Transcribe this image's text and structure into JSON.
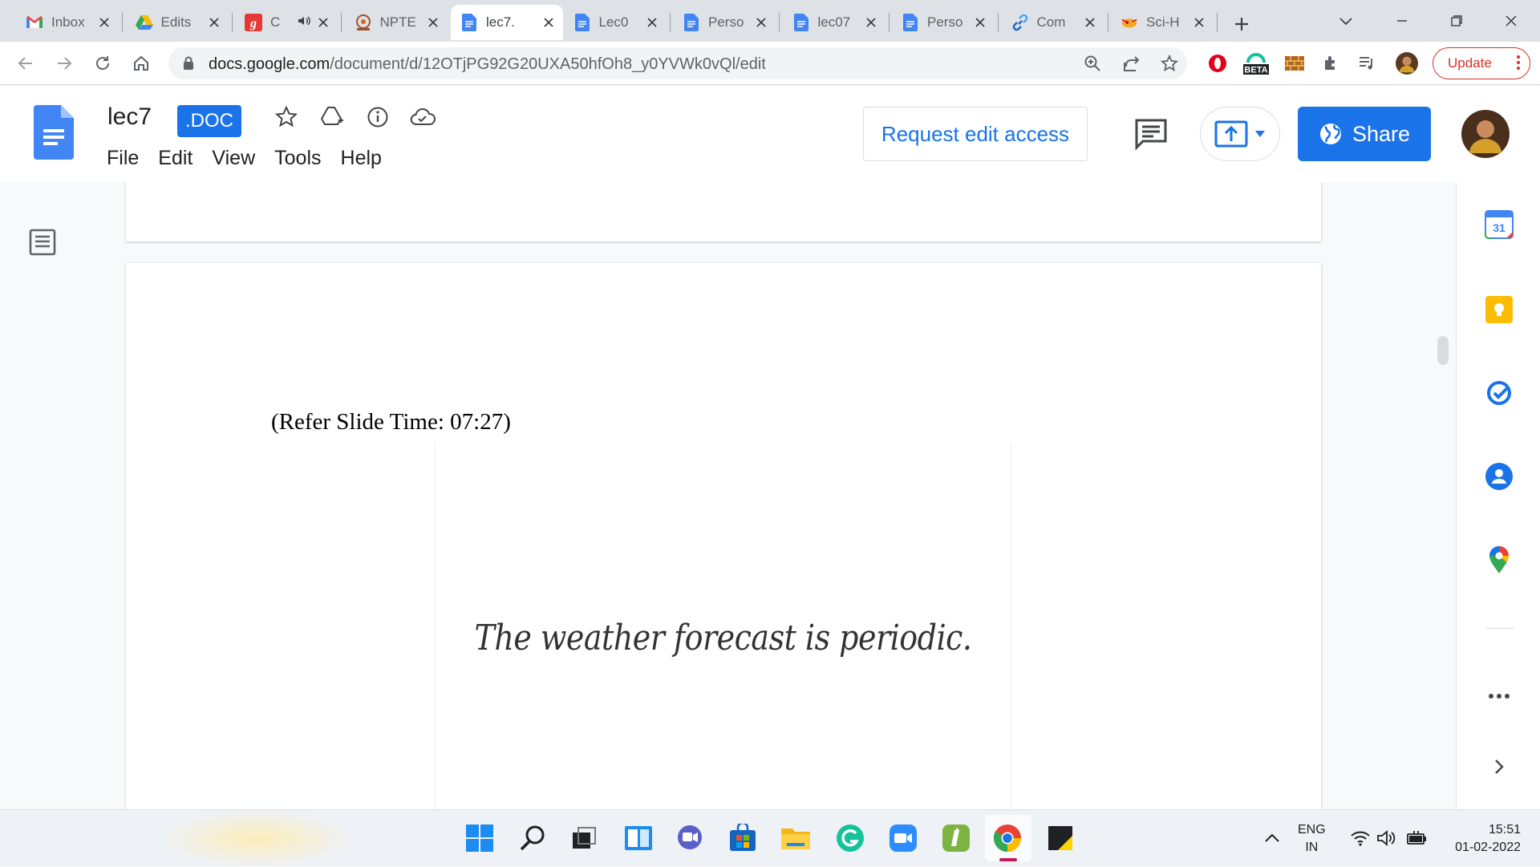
{
  "browser": {
    "tabs": [
      {
        "title": "Inbox",
        "icon": "gmail-icon",
        "active": false
      },
      {
        "title": "Edits",
        "icon": "google-drive-icon",
        "active": false
      },
      {
        "title": "C",
        "icon": "g-red-icon",
        "active": false,
        "audio": true
      },
      {
        "title": "NPTE",
        "icon": "nptel-icon",
        "active": false
      },
      {
        "title": "lec7.",
        "icon": "google-docs-icon",
        "active": true
      },
      {
        "title": "Lec0",
        "icon": "google-docs-icon",
        "active": false
      },
      {
        "title": "Perso",
        "icon": "google-docs-icon",
        "active": false
      },
      {
        "title": "lec07",
        "icon": "google-docs-icon",
        "active": false
      },
      {
        "title": "Perso",
        "icon": "google-docs-icon",
        "active": false
      },
      {
        "title": "Com",
        "icon": "link-icon",
        "active": false
      },
      {
        "title": "Sci-H",
        "icon": "sci-hub-icon",
        "active": false
      }
    ],
    "url_host": "docs.google.com",
    "url_path": "/document/d/12OTjPG92G20UXA50hfOh8_y0YVWk0vQl/edit",
    "update_label": "Update",
    "beta_label": "BETA"
  },
  "docs": {
    "title": "lec7",
    "badge": ".DOC",
    "menu": [
      "File",
      "Edit",
      "View",
      "Tools",
      "Help"
    ],
    "request_edit_label": "Request edit access",
    "share_label": "Share"
  },
  "document": {
    "slide_ref": "(Refer Slide Time: 07:27)",
    "slide_text": "The weather forecast is periodic."
  },
  "side_panel": {
    "calendar_day": "31"
  },
  "taskbar": {
    "lang_top": "ENG",
    "lang_bottom": "IN",
    "time": "15:51",
    "date": "01-02-2022"
  },
  "colors": {
    "accent": "#1a73e8",
    "update_red": "#d93025",
    "tab_strip": "#dee1e6"
  }
}
